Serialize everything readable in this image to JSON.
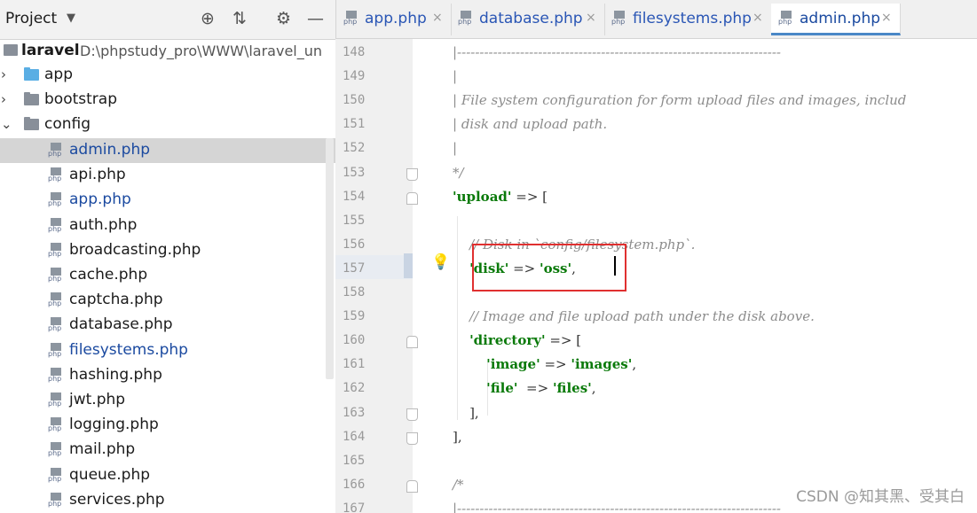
{
  "project_panel": {
    "title": "Project",
    "root": {
      "name": "laravel",
      "path": "D:\\phpstudy_pro\\WWW\\laravel_un"
    },
    "folders": [
      {
        "label": "app",
        "color": "#5aaee4",
        "arrow": "›"
      },
      {
        "label": "bootstrap",
        "color": "#888f99",
        "arrow": "›"
      },
      {
        "label": "config",
        "color": "#888f99",
        "arrow": "⌄"
      }
    ],
    "files": [
      {
        "label": "admin.php",
        "color": "#1b4aa0"
      },
      {
        "label": "api.php",
        "color": "#1b1b1b"
      },
      {
        "label": "app.php",
        "color": "#1b4aa0"
      },
      {
        "label": "auth.php",
        "color": "#1b1b1b"
      },
      {
        "label": "broadcasting.php",
        "color": "#1b1b1b"
      },
      {
        "label": "cache.php",
        "color": "#1b1b1b"
      },
      {
        "label": "captcha.php",
        "color": "#1b1b1b"
      },
      {
        "label": "database.php",
        "color": "#1b1b1b"
      },
      {
        "label": "filesystems.php",
        "color": "#1b4aa0"
      },
      {
        "label": "hashing.php",
        "color": "#1b1b1b"
      },
      {
        "label": "jwt.php",
        "color": "#1b1b1b"
      },
      {
        "label": "logging.php",
        "color": "#1b1b1b"
      },
      {
        "label": "mail.php",
        "color": "#1b1b1b"
      },
      {
        "label": "queue.php",
        "color": "#1b1b1b"
      },
      {
        "label": "services.php",
        "color": "#1b1b1b"
      }
    ],
    "icons": [
      "target-icon",
      "collapse-icon",
      "gear-icon",
      "minimize-icon"
    ]
  },
  "tabs": [
    {
      "label": "app.php",
      "close": "×"
    },
    {
      "label": "database.php",
      "close": "×"
    },
    {
      "label": "filesystems.php",
      "close": "×"
    },
    {
      "label": "admin.php",
      "close": "×"
    }
  ],
  "php_badge": "php",
  "editor": {
    "line_numbers": [
      "148",
      "149",
      "150",
      "151",
      "152",
      "153",
      "154",
      "155",
      "156",
      "157",
      "158",
      "159",
      "160",
      "161",
      "162",
      "163",
      "164",
      "165",
      "166",
      "167"
    ],
    "lines": [
      {
        "parts": [
          {
            "t": "|------------------------------------------------------------------------",
            "c": "c-comment"
          }
        ]
      },
      {
        "parts": [
          {
            "t": "|",
            "c": "c-comment"
          }
        ]
      },
      {
        "parts": [
          {
            "t": "| File system configuration for form upload files and images, includ",
            "c": "c-comment"
          }
        ]
      },
      {
        "parts": [
          {
            "t": "| disk and upload path.",
            "c": "c-comment"
          }
        ]
      },
      {
        "parts": [
          {
            "t": "|",
            "c": "c-comment"
          }
        ]
      },
      {
        "parts": [
          {
            "t": "*/",
            "c": "c-comment"
          }
        ]
      },
      {
        "parts": [
          {
            "t": "'upload'",
            "c": "c-key"
          },
          {
            "t": " => [",
            "c": "c-op"
          }
        ]
      },
      {
        "parts": []
      },
      {
        "parts": [
          {
            "t": "    // Disk in `config/filesystem.php`.",
            "c": "c-comment"
          }
        ]
      },
      {
        "parts": [
          {
            "t": "    ",
            "c": "c-op"
          },
          {
            "t": "'disk'",
            "c": "c-key"
          },
          {
            "t": " => ",
            "c": "c-op"
          },
          {
            "t": "'oss'",
            "c": "c-key"
          },
          {
            "t": ",",
            "c": "c-op"
          }
        ]
      },
      {
        "parts": []
      },
      {
        "parts": [
          {
            "t": "    // Image and file upload path under the disk above.",
            "c": "c-comment"
          }
        ]
      },
      {
        "parts": [
          {
            "t": "    ",
            "c": "c-op"
          },
          {
            "t": "'directory'",
            "c": "c-key"
          },
          {
            "t": " => [",
            "c": "c-op"
          }
        ]
      },
      {
        "parts": [
          {
            "t": "        ",
            "c": "c-op"
          },
          {
            "t": "'image'",
            "c": "c-key"
          },
          {
            "t": " => ",
            "c": "c-op"
          },
          {
            "t": "'images'",
            "c": "c-key"
          },
          {
            "t": ",",
            "c": "c-op"
          }
        ]
      },
      {
        "parts": [
          {
            "t": "        ",
            "c": "c-op"
          },
          {
            "t": "'file'",
            "c": "c-key"
          },
          {
            "t": "  => ",
            "c": "c-op"
          },
          {
            "t": "'files'",
            "c": "c-key"
          },
          {
            "t": ",",
            "c": "c-op"
          }
        ]
      },
      {
        "parts": [
          {
            "t": "    ],",
            "c": "c-op"
          }
        ]
      },
      {
        "parts": [
          {
            "t": "],",
            "c": "c-op"
          }
        ]
      },
      {
        "parts": []
      },
      {
        "parts": [
          {
            "t": "/*",
            "c": "c-comment"
          }
        ]
      },
      {
        "parts": [
          {
            "t": "|------------------------------------------------------------------------",
            "c": "c-comment"
          }
        ]
      }
    ]
  },
  "watermark": "CSDN @知其黑、受其白"
}
